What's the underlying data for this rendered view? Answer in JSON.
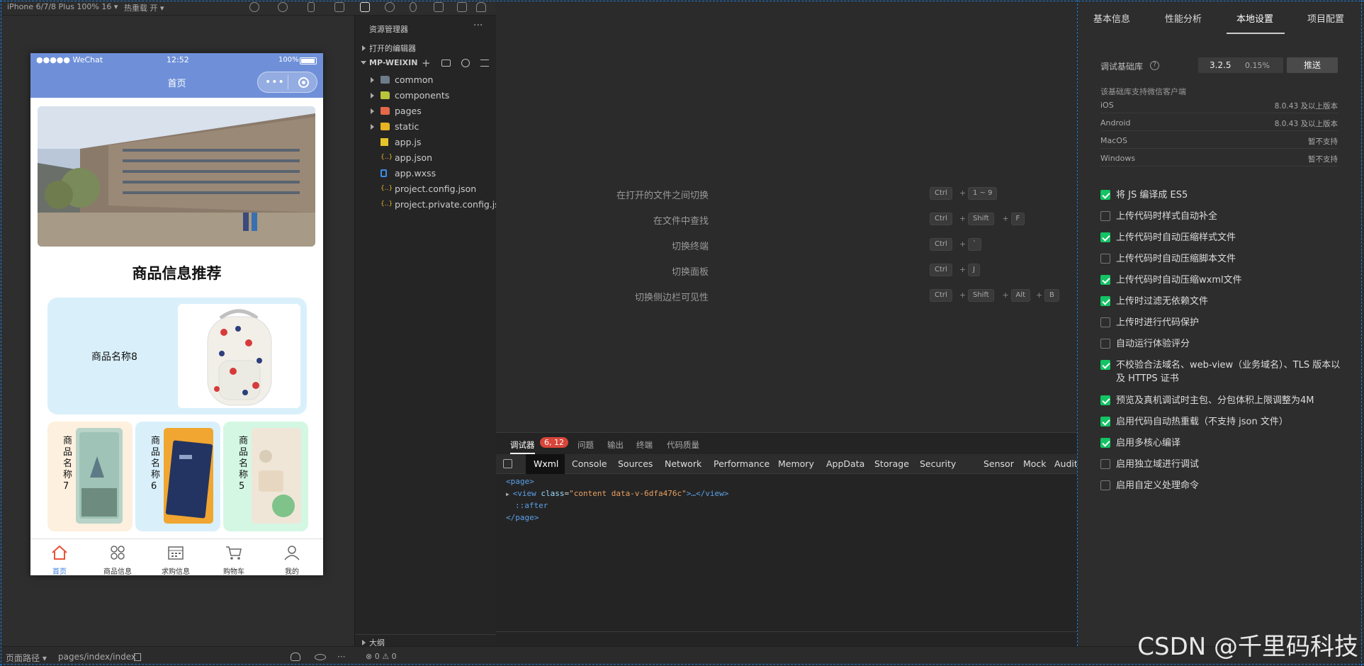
{
  "toolbar": {
    "device": "iPhone 6/7/8 Plus 100% 16 ▾",
    "hot_reload": "热重载 开 ▾"
  },
  "simulator": {
    "status": {
      "carrier": "●●●●● WeChat",
      "time": "12:52",
      "battery": "100%"
    },
    "nav_title": "首页",
    "section_title": "商品信息推荐",
    "featured_name": "商品名称8",
    "small_cards": [
      {
        "name": "商品名称7",
        "color": "#fdf0de"
      },
      {
        "name": "商品名称6",
        "color": "#d9f0fb"
      },
      {
        "name": "商品名称5",
        "color": "#d4f7e4"
      }
    ],
    "tabs": [
      {
        "label": "首页",
        "icon": "home-icon",
        "active": true
      },
      {
        "label": "商品信息",
        "icon": "grid-icon",
        "active": false
      },
      {
        "label": "求购信息",
        "icon": "calendar-icon",
        "active": false
      },
      {
        "label": "购物车",
        "icon": "cart-icon",
        "active": false
      },
      {
        "label": "我的",
        "icon": "user-icon",
        "active": false
      }
    ],
    "accent": "#6f90d9"
  },
  "explorer": {
    "title": "资源管理器",
    "open_editors": "打开的编辑器",
    "project": "MP-WEIXIN",
    "items": [
      {
        "name": "common",
        "type": "folder",
        "color": "#6d7b8a"
      },
      {
        "name": "components",
        "type": "folder",
        "color": "#b8c63a"
      },
      {
        "name": "pages",
        "type": "folder",
        "color": "#e5684b"
      },
      {
        "name": "static",
        "type": "folder",
        "color": "#e6b422"
      },
      {
        "name": "app.js",
        "type": "js",
        "color": "#e6c229"
      },
      {
        "name": "app.json",
        "type": "json",
        "color": "#e6b422"
      },
      {
        "name": "app.wxss",
        "type": "css",
        "color": "#3b8ee8"
      },
      {
        "name": "project.config.json",
        "type": "json",
        "color": "#e6b422"
      },
      {
        "name": "project.private.config.js...",
        "type": "json",
        "color": "#e6b422"
      }
    ],
    "outline": "大纲"
  },
  "shortcuts": [
    {
      "label": "在打开的文件之间切换",
      "keys": [
        "Ctrl",
        "1 ~ 9"
      ]
    },
    {
      "label": "在文件中查找",
      "keys": [
        "Ctrl",
        "Shift",
        "F"
      ]
    },
    {
      "label": "切换终端",
      "keys": [
        "Ctrl",
        "`"
      ]
    },
    {
      "label": "切换面板",
      "keys": [
        "Ctrl",
        "J"
      ]
    },
    {
      "label": "切换侧边栏可见性",
      "keys": [
        "Ctrl",
        "Shift",
        "Alt",
        "B"
      ]
    }
  ],
  "debugger": {
    "tabs": [
      "调试器",
      "问题",
      "输出",
      "终端",
      "代码质量"
    ],
    "badge": "6, 12",
    "devtools_tabs": [
      "Wxml",
      "Console",
      "Sources",
      "Network",
      "Performance",
      "Memory",
      "AppData",
      "Storage",
      "Security",
      "Sensor",
      "Mock",
      "Audits"
    ],
    "code": {
      "page_open": "<page>",
      "view_tag_start": "<view ",
      "attr_name": "class",
      "attr_value": "\"content data-v-6dfa476c\"",
      "view_tag_end": ">…</view>",
      "after": "::after",
      "page_close": "</page>"
    }
  },
  "settings": {
    "tabs": [
      "基本信息",
      "性能分析",
      "本地设置",
      "项目配置"
    ],
    "active_tab": "本地设置",
    "lib_label": "调试基础库",
    "lib_version": "3.2.5",
    "lib_percent": "0.15%",
    "push_button": "推送",
    "support_note": "该基础库支持微信客户端",
    "platforms": [
      {
        "name": "iOS",
        "value": "8.0.43 及以上版本"
      },
      {
        "name": "Android",
        "value": "8.0.43 及以上版本"
      },
      {
        "name": "MacOS",
        "value": "暂不支持"
      },
      {
        "name": "Windows",
        "value": "暂不支持"
      }
    ],
    "options": [
      {
        "label": "将 JS 编译成 ES5",
        "checked": true
      },
      {
        "label": "上传代码时样式自动补全",
        "checked": false
      },
      {
        "label": "上传代码时自动压缩样式文件",
        "checked": true
      },
      {
        "label": "上传代码时自动压缩脚本文件",
        "checked": false
      },
      {
        "label": "上传代码时自动压缩wxml文件",
        "checked": true
      },
      {
        "label": "上传时过滤无依赖文件",
        "checked": true
      },
      {
        "label": "上传时进行代码保护",
        "checked": false
      },
      {
        "label": "自动运行体验评分",
        "checked": false
      },
      {
        "label": "不校验合法域名、web-view（业务域名）、TLS 版本以及 HTTPS 证书",
        "checked": true
      },
      {
        "label": "预览及真机调试时主包、分包体积上限调整为4M",
        "checked": true
      },
      {
        "label": "启用代码自动热重载（不支持 json 文件）",
        "checked": true
      },
      {
        "label": "启用多核心编译",
        "checked": true
      },
      {
        "label": "启用独立域进行调试",
        "checked": false
      },
      {
        "label": "启用自定义处理命令",
        "checked": false
      }
    ]
  },
  "statusbar": {
    "page_path_label": "页面路径 ▾",
    "page_path": "pages/index/index",
    "errors": "⊗ 0 ⚠ 0"
  },
  "watermark": "CSDN @千里码科技"
}
